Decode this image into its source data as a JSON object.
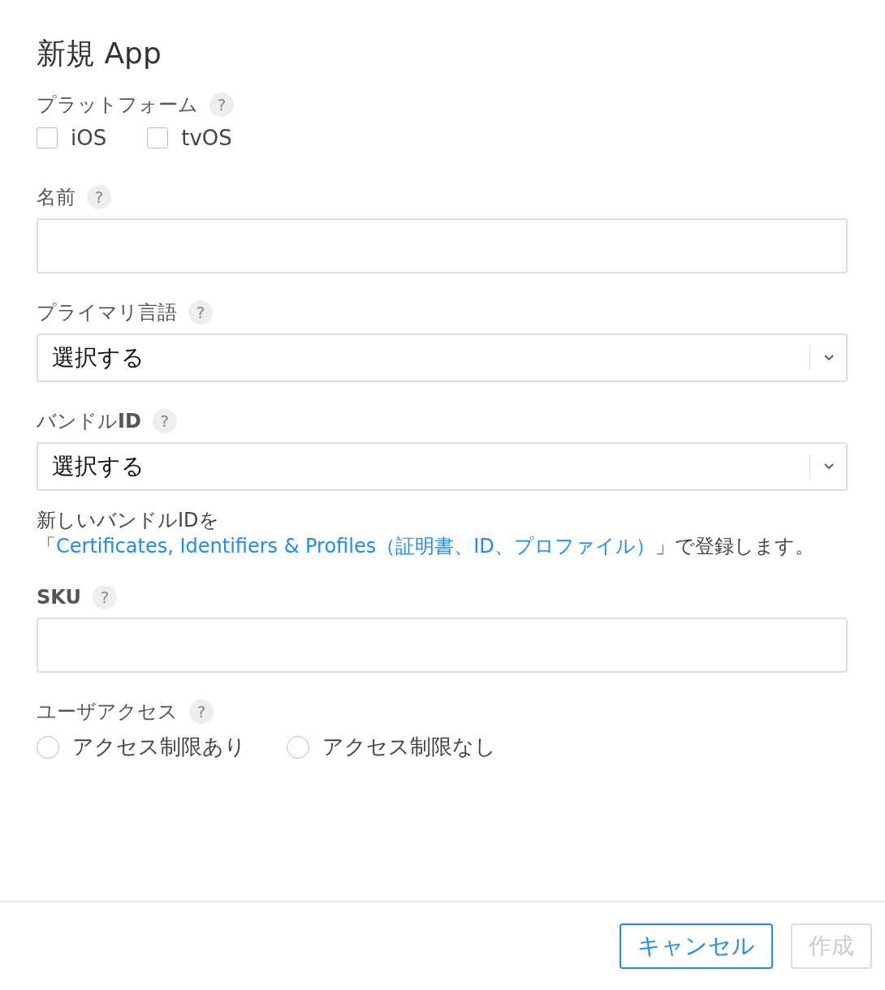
{
  "title": "新規 App",
  "sections": [
    {
      "kind": "checkboxes",
      "label": "プラットフォーム",
      "help": "?",
      "options": [
        {
          "label": "iOS",
          "checked": false
        },
        {
          "label": "tvOS",
          "checked": false
        }
      ]
    },
    {
      "kind": "text",
      "label": "名前",
      "help": "?"
    },
    {
      "kind": "select",
      "label": "プライマリ言語",
      "help": "?",
      "value": "選択する"
    },
    {
      "kind": "select",
      "label": "バンドル**ID**",
      "help": "?",
      "value": "選択する",
      "note": {
        "before": "新しいバンドルIDを「",
        "link": "Certificates, Identifiers & Profiles（証明書、ID、プロファイル）",
        "after": "」で登録します。"
      }
    },
    {
      "kind": "text",
      "label": "**SKU**",
      "help": "?"
    },
    {
      "kind": "radios",
      "label": "ユーザアクセス",
      "help": "?",
      "options": [
        {
          "label": "アクセス制限あり",
          "selected": false
        },
        {
          "label": "アクセス制限なし",
          "selected": false
        }
      ]
    }
  ],
  "buttons": [
    {
      "label": "キャンセル",
      "kind": "secondary",
      "disabled": false
    },
    {
      "label": "作成",
      "kind": "primary",
      "disabled": true
    }
  ]
}
